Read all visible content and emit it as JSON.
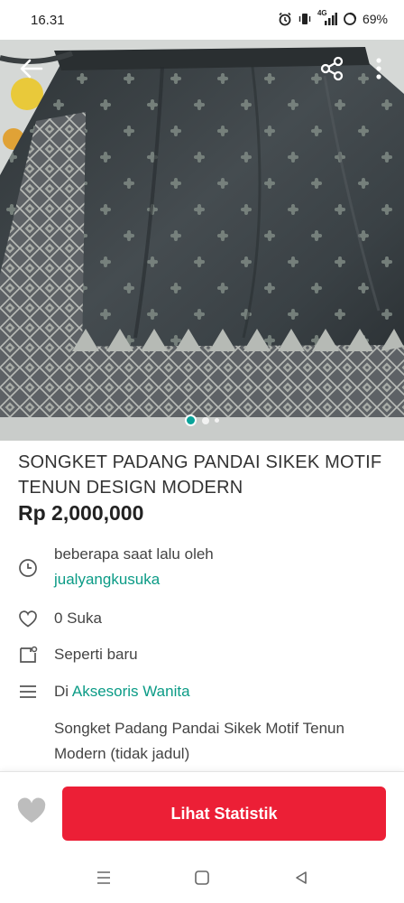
{
  "status_bar": {
    "time": "16.31",
    "network": "4G",
    "battery": "69%",
    "icons": [
      "alarm-icon",
      "vibrate-icon",
      "signal-icon",
      "battery-icon"
    ]
  },
  "hero": {
    "image": "songket-skirt-photo",
    "carousel_count": 3,
    "carousel_active": 1,
    "icons": [
      "back-arrow-icon",
      "share-icon",
      "more-vertical-icon"
    ]
  },
  "listing": {
    "title": "SONGKET PADANG PANDAI SIKEK MOTIF TENUN DESIGN MODERN",
    "price": "Rp 2,000,000",
    "posted_text": "beberapa saat lalu oleh",
    "seller": "jualyangkusuka",
    "likes": "0 Suka",
    "condition": "Seperti baru",
    "category_prefix": "Di",
    "category": "Aksesoris Wanita",
    "description": "Songket Padang Pandai Sikek Motif Tenun Modern (tidak jadul)"
  },
  "actions": {
    "stats_label": "Lihat Statistik"
  },
  "colors": {
    "accent_green": "#0b9b86",
    "button_red": "#ec1f36",
    "carousel_active": "#0aa39a"
  }
}
